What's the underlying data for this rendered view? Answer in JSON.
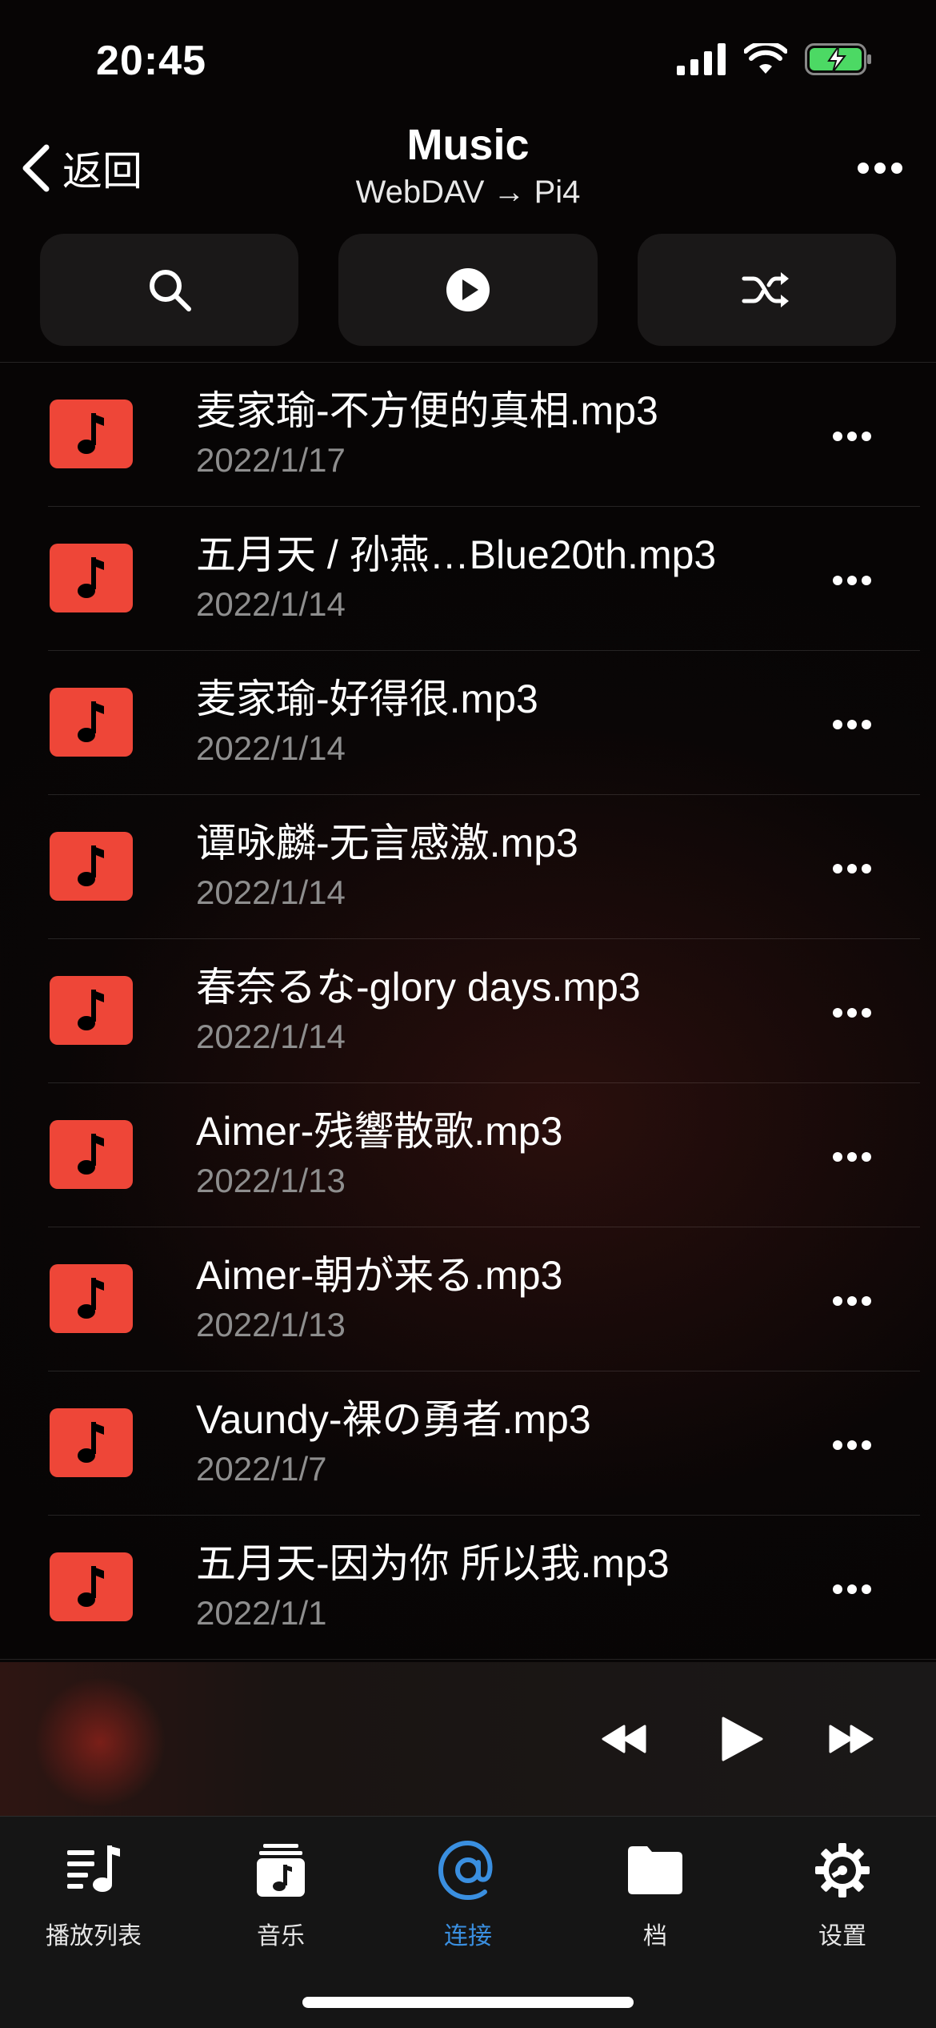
{
  "status": {
    "time": "20:45"
  },
  "nav": {
    "back_label": "返回",
    "title": "Music",
    "subtitle": "WebDAV → Pi4"
  },
  "toolbar": {
    "buttons": [
      "search-icon",
      "play-circle-icon",
      "shuffle-icon"
    ]
  },
  "songs": [
    {
      "title": "麦家瑜-不方便的真相.mp3",
      "date": "2022/1/17"
    },
    {
      "title": "五月天 / 孙燕…Blue20th.mp3",
      "date": "2022/1/14"
    },
    {
      "title": "麦家瑜-好得很.mp3",
      "date": "2022/1/14"
    },
    {
      "title": "谭咏麟-无言感激.mp3",
      "date": "2022/1/14"
    },
    {
      "title": "春奈るな-glory days.mp3",
      "date": "2022/1/14"
    },
    {
      "title": "Aimer-残響散歌.mp3",
      "date": "2022/1/13"
    },
    {
      "title": "Aimer-朝が来る.mp3",
      "date": "2022/1/13"
    },
    {
      "title": "Vaundy-裸の勇者.mp3",
      "date": "2022/1/7"
    },
    {
      "title": "五月天-因为你 所以我.mp3",
      "date": "2022/1/1"
    }
  ],
  "tabs": [
    {
      "label": "播放列表",
      "icon": "playlist-icon",
      "active": false
    },
    {
      "label": "音乐",
      "icon": "music-library-icon",
      "active": false
    },
    {
      "label": "连接",
      "icon": "at-icon",
      "active": true
    },
    {
      "label": "档",
      "icon": "folder-icon",
      "active": false
    },
    {
      "label": "设置",
      "icon": "gear-icon",
      "active": false
    }
  ],
  "colors": {
    "accent": "#3a8fe0",
    "song_thumb": "#ee4638",
    "battery": "#4cd964"
  }
}
